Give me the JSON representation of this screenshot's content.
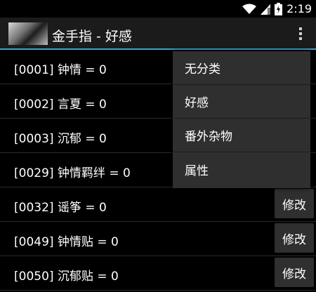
{
  "status_bar": {
    "time": "2:19"
  },
  "action_bar": {
    "title": "金手指 - 好感"
  },
  "rows": [
    {
      "label": "[0001] 钟情 = 0"
    },
    {
      "label": "[0002] 言夏 = 0"
    },
    {
      "label": "[0003] 沉郁 = 0"
    },
    {
      "label": "[0029] 钟情羁绊 = 0"
    },
    {
      "label": "[0032] 谣筝 = 0",
      "button": "修改"
    },
    {
      "label": "[0049] 钟情贴 = 0",
      "button": "修改"
    },
    {
      "label": "[0050] 沉郁贴 = 0",
      "button": "修改"
    }
  ],
  "menu": {
    "items": [
      "无分类",
      "好感",
      "番外杂物",
      "属性"
    ]
  }
}
